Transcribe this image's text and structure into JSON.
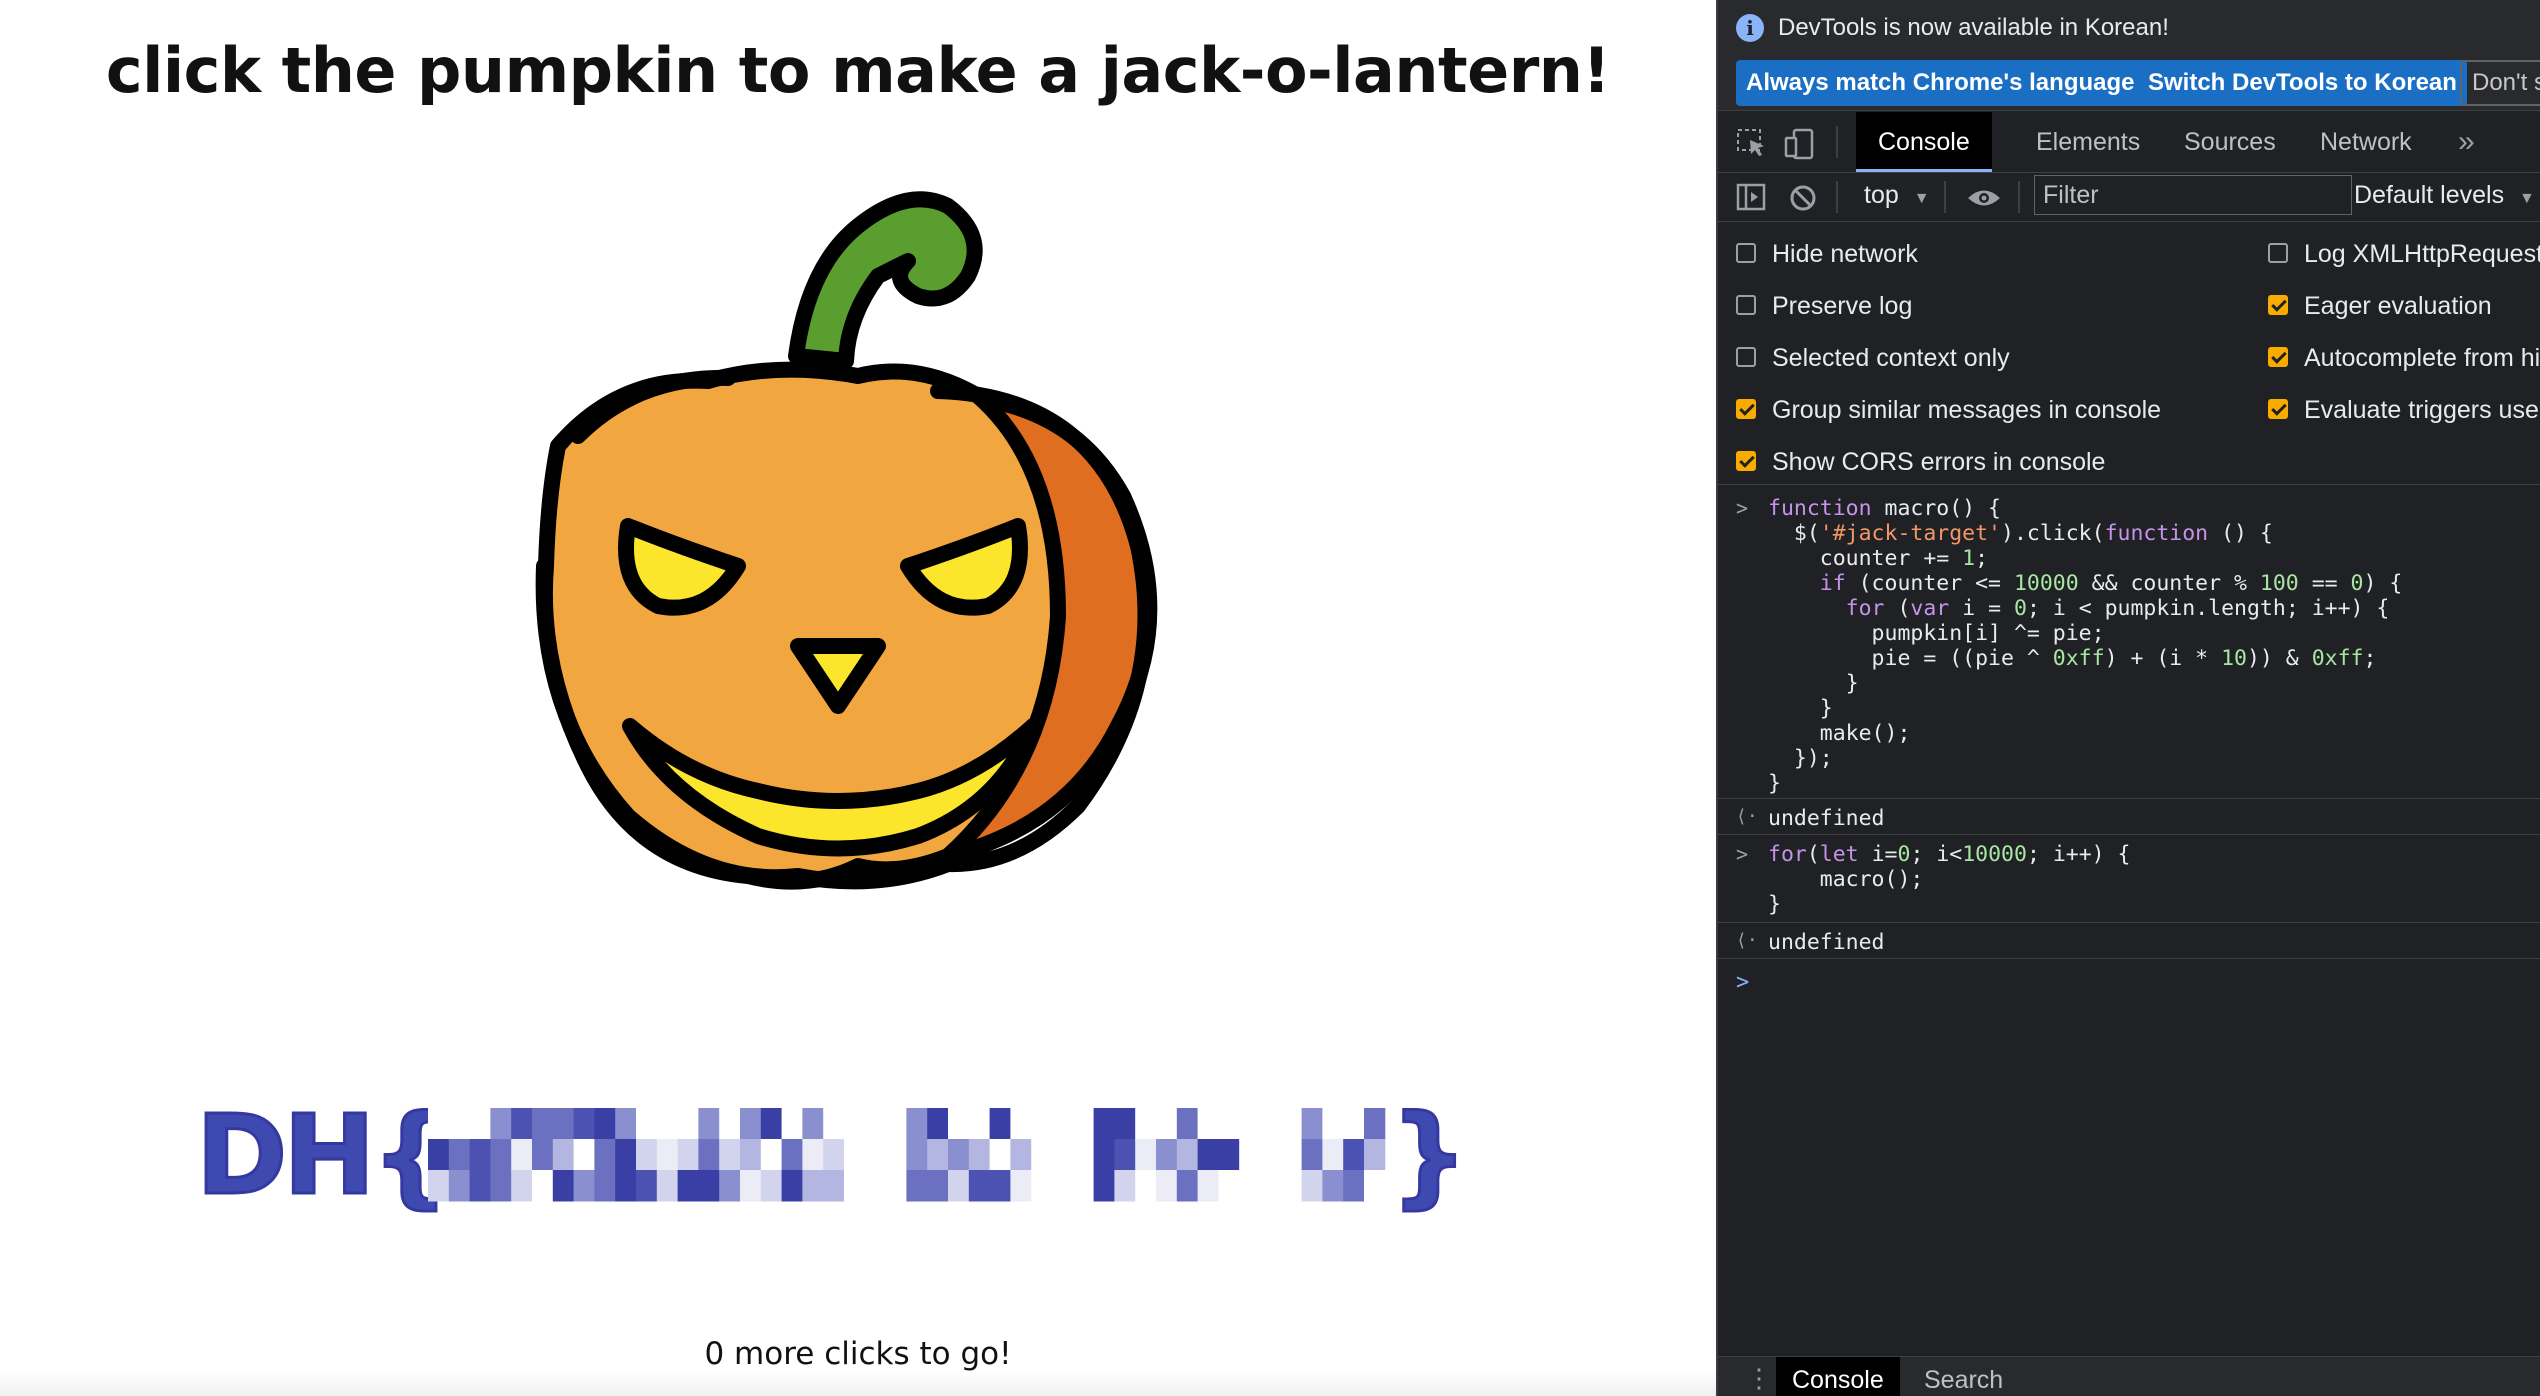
{
  "page": {
    "headline": "click the pumpkin to make a jack-o-lantern!",
    "flag_prefix": "DH{",
    "flag_suffix": "}",
    "counter_text": "0 more clicks to go!"
  },
  "devtools": {
    "infobar": {
      "message": "DevTools is now available in Korean!",
      "match_button": "Always match Chrome's language",
      "switch_button": "Switch DevTools to Korean",
      "dont_button": "Don't s"
    },
    "tabs": [
      "Console",
      "Elements",
      "Sources",
      "Network"
    ],
    "more_tabs": "»",
    "toolbar": {
      "context": "top",
      "filter_placeholder": "Filter",
      "levels": "Default levels"
    },
    "settings_left": [
      {
        "label": "Hide network",
        "checked": false
      },
      {
        "label": "Preserve log",
        "checked": false
      },
      {
        "label": "Selected context only",
        "checked": false
      },
      {
        "label": "Group similar messages in console",
        "checked": true
      },
      {
        "label": "Show CORS errors in console",
        "checked": true
      }
    ],
    "settings_right": [
      {
        "label": "Log XMLHttpRequests",
        "checked": false
      },
      {
        "label": "Eager evaluation",
        "checked": true
      },
      {
        "label": "Autocomplete from his",
        "checked": true
      },
      {
        "label": "Evaluate triggers user",
        "checked": true
      }
    ],
    "console": {
      "input1_lines": [
        "function macro() {",
        "  $('#jack-target').click(function () {",
        "    counter += 1;",
        "    if (counter <= 10000 && counter % 100 == 0) {",
        "      for (var i = 0; i < pumpkin.length; i++) {",
        "        pumpkin[i] ^= pie;",
        "        pie = ((pie ^ 0xff) + (i * 10)) & 0xff;",
        "      }",
        "    }",
        "    make();",
        "  });",
        "}"
      ],
      "result1": "undefined",
      "input2_lines": [
        "for(let i=0; i<10000; i++) {",
        "    macro();",
        "}"
      ],
      "result2": "undefined"
    },
    "drawer_tabs": [
      "Console",
      "Search"
    ]
  },
  "colors": {
    "flag": "#3f4ab0",
    "pumpkin_body": "#f2a640",
    "pumpkin_side": "#e06e21",
    "stem": "#5a9e2f",
    "eyes": "#fce62b",
    "devtools_bg": "#202124",
    "accent_blue": "#1a6fc4",
    "checkbox": "#f9ab00"
  }
}
